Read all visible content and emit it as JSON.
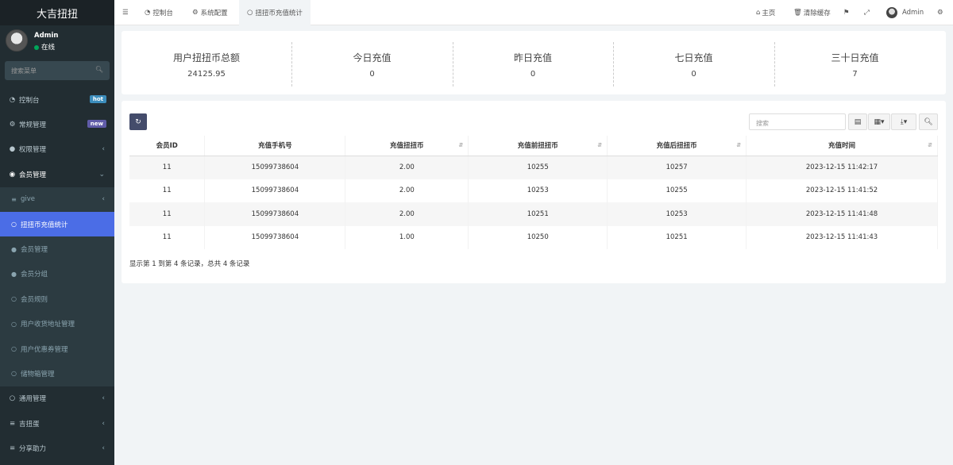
{
  "app": {
    "title": "大吉扭扭"
  },
  "user": {
    "name": "Admin",
    "status": "在线"
  },
  "sidebar": {
    "search_placeholder": "搜索菜单",
    "items": [
      {
        "label": "控制台",
        "icon": "dashboard-icon",
        "badge": "hot"
      },
      {
        "label": "常规管理",
        "icon": "cogs-icon",
        "badge": "new"
      },
      {
        "label": "权限管理",
        "icon": "group-icon"
      },
      {
        "label": "会员管理",
        "icon": "user-circle-icon"
      },
      {
        "label": "give",
        "icon": "list-icon"
      },
      {
        "label": "扭扭币充值统计",
        "icon": "circle-icon"
      },
      {
        "label": "会员管理",
        "icon": "user-icon"
      },
      {
        "label": "会员分组",
        "icon": "users-icon"
      },
      {
        "label": "会员规则",
        "icon": "circle-icon"
      },
      {
        "label": "用户收货地址管理",
        "icon": "circle-icon"
      },
      {
        "label": "用户优惠券管理",
        "icon": "circle-icon"
      },
      {
        "label": "储物箱管理",
        "icon": "circle-icon"
      },
      {
        "label": "通用管理",
        "icon": "circle-icon"
      },
      {
        "label": "吉扭蛋",
        "icon": "list-icon"
      },
      {
        "label": "分享助力",
        "icon": "list-icon"
      }
    ]
  },
  "topbar": {
    "tabs": [
      {
        "label": "控制台"
      },
      {
        "label": "系统配置"
      },
      {
        "label": "扭扭币充值统计"
      }
    ],
    "home": "主页",
    "clear_cache": "清除缓存",
    "admin": "Admin"
  },
  "stats": [
    {
      "label": "用户扭扭币总额",
      "value": "24125.95"
    },
    {
      "label": "今日充值",
      "value": "0"
    },
    {
      "label": "昨日充值",
      "value": "0"
    },
    {
      "label": "七日充值",
      "value": "0"
    },
    {
      "label": "三十日充值",
      "value": "7"
    }
  ],
  "table": {
    "search_placeholder": "搜索",
    "columns": [
      "会员ID",
      "充值手机号",
      "充值扭扭币",
      "充值前扭扭币",
      "充值后扭扭币",
      "充值时间"
    ],
    "rows": [
      [
        "11",
        "15099738604",
        "2.00",
        "10255",
        "10257",
        "2023-12-15 11:42:17"
      ],
      [
        "11",
        "15099738604",
        "2.00",
        "10253",
        "10255",
        "2023-12-15 11:41:52"
      ],
      [
        "11",
        "15099738604",
        "2.00",
        "10251",
        "10253",
        "2023-12-15 11:41:48"
      ],
      [
        "11",
        "15099738604",
        "1.00",
        "10250",
        "10251",
        "2023-12-15 11:41:43"
      ]
    ],
    "summary": "显示第 1 到第 4 条记录，总共 4 条记录"
  },
  "colors": {
    "sidebar_bg": "#222d32",
    "active": "#4b6de6",
    "hot": "#3c8dbc",
    "new": "#605ca8"
  }
}
